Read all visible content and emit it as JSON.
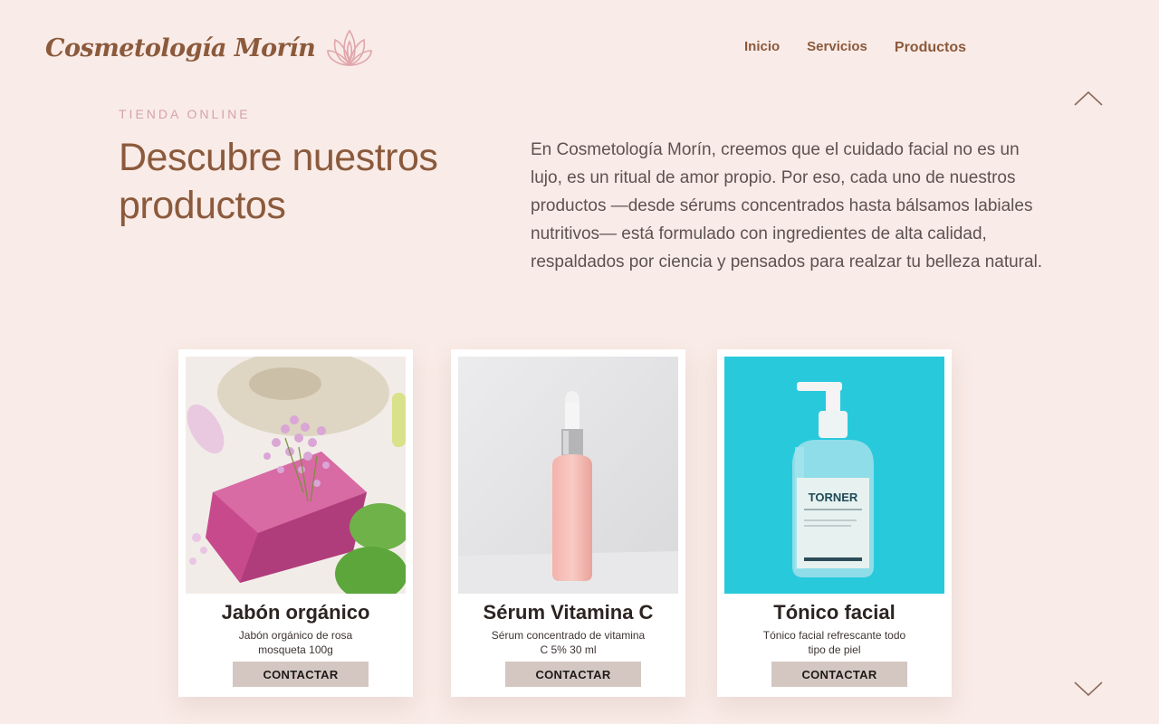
{
  "brand": {
    "name": "Cosmetología Morín",
    "logo_icon": "lotus-icon",
    "accent_color": "#8b5a3c"
  },
  "nav": {
    "items": [
      {
        "label": "Inicio"
      },
      {
        "label": "Servicios"
      },
      {
        "label": "Productos"
      }
    ]
  },
  "section": {
    "eyebrow": "TIENDA ONLINE",
    "title": "Descubre nuestros productos",
    "intro": "En Cosmetología Morín, creemos que el cuidado facial no es un lujo, es un ritual de amor propio. Por eso, cada uno de nuestros productos —desde sérums concentrados hasta bálsamos labiales nutritivos— está formulado con ingredientes de alta calidad, respaldados por ciencia y pensados para realzar tu belleza natural."
  },
  "scroll": {
    "up_icon": "chevron-up-icon",
    "down_icon": "chevron-down-icon"
  },
  "products": [
    {
      "title": "Jabón orgánico",
      "description": "Jabón orgánico de rosa mosqueta 100g",
      "button": "CONTACTAR"
    },
    {
      "title": "Sérum Vitamina C",
      "description": "Sérum concentrado de vitamina C 5% 30 ml",
      "button": "CONTACTAR"
    },
    {
      "title": "Tónico facial",
      "description": "Tónico facial refrescante todo tipo de piel",
      "button": "CONTACTAR",
      "bottle_label": "TORNER"
    }
  ]
}
